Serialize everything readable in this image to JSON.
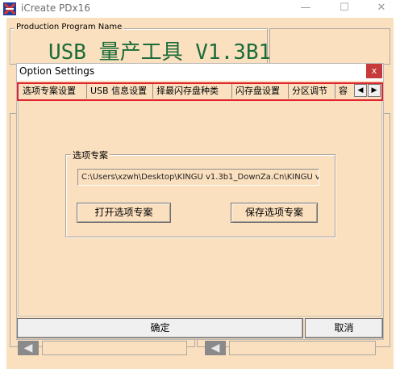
{
  "window": {
    "title": "iCreate PDx16",
    "minimize_glyph": "—",
    "maximize_glyph": "☐",
    "close_glyph": "✕"
  },
  "main": {
    "program_group_label": "Production Program Name",
    "program_title": "USB 量产工具 V1.3B1"
  },
  "dialog": {
    "title": "Option Settings",
    "close_glyph": "x",
    "tabs": [
      {
        "label": "选项专案设置"
      },
      {
        "label": "USB 信息设置"
      },
      {
        "label": "择最闪存盘种类"
      },
      {
        "label": "闪存盘设置"
      },
      {
        "label": "分区调节"
      },
      {
        "label": "容"
      }
    ],
    "tab_scroll_left": "◀",
    "tab_scroll_right": "▶",
    "project_group_label": "选项专案",
    "project_path": "C:\\Users\\xzwh\\Desktop\\KINGU v1.3b1_DownZa.Cn\\KINGU v",
    "open_button": "打开选项专案",
    "save_button": "保存选项专案",
    "ok_button": "确定",
    "cancel_button": "取消"
  },
  "icons": {
    "app_icon": "app-logo-icon",
    "arrow_icon": "arrow-left-icon"
  },
  "colors": {
    "dialog_bg": "#fbe0bf",
    "title_green": "#1b6c39",
    "close_red": "#c73a3a",
    "highlight_red": "#e0242e"
  }
}
